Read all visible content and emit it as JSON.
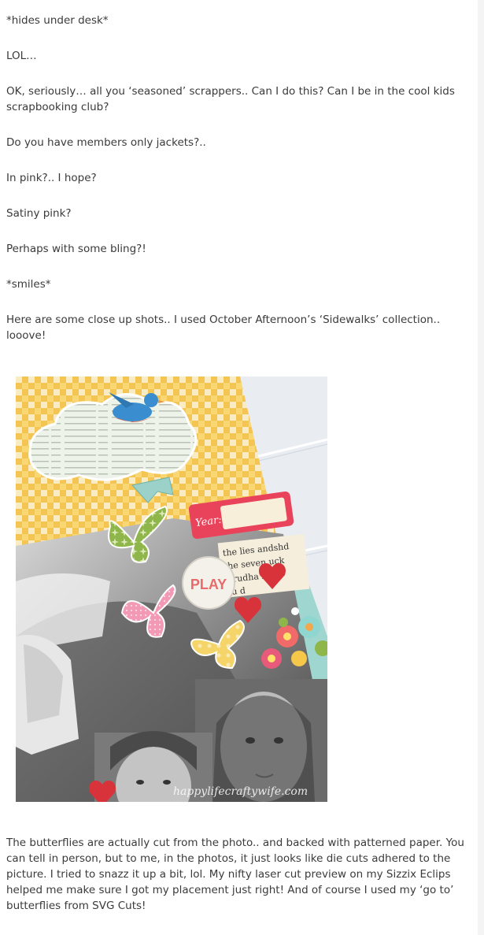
{
  "paragraphs": [
    "*hides under desk*",
    "LOL…",
    "OK, seriously…  all you ‘seasoned’ scrappers.. Can I do this? Can I be in the cool kids scrapbooking club?",
    "Do you have members only jackets?..",
    "In pink?.. I hope?",
    "Satiny pink?",
    "Perhaps with some bling?!",
    "*smiles*",
    "Here are some close up shots.. I used October Afternoon’s ‘Sidewalks’ collection.. looove!"
  ],
  "photo": {
    "stickers": {
      "year_label": "Year:",
      "play_button": "PLAY",
      "text_strip_lines": [
        "the lies andshd",
        "the seven uck",
        "wrudha buel",
        "cu d"
      ]
    },
    "watermark": "happylifecraftywife.com"
  },
  "closing_paragraph": "The butterflies are actually cut from the photo.. and backed with patterned paper. You can tell in person, but to me, in the photos, it just looks like die cuts adhered to the picture. I tried to snazz it up a bit, lol. My nifty laser cut preview on my Sizzix Eclips helped me make sure I got my placement just right! And of course I used my ‘go to’ butterflies from SVG Cuts!",
  "colors": {
    "text": "#3a3a3a",
    "gingham": "#f5c24a",
    "heart_red": "#d8323a",
    "label_pink": "#e8435a"
  }
}
